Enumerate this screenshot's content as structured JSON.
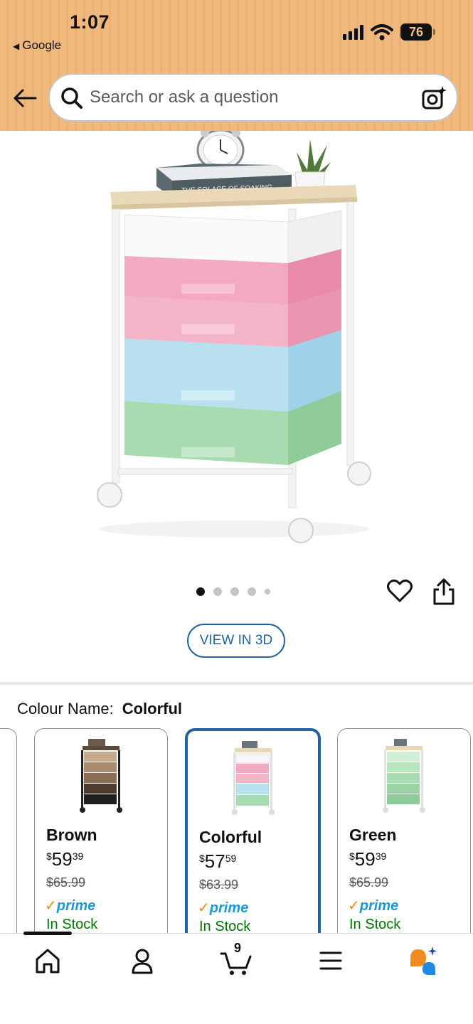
{
  "status_bar": {
    "time": "1:07",
    "back_app": "Google",
    "battery": "76"
  },
  "search": {
    "placeholder": "Search or ask a question"
  },
  "carousel": {
    "view_3d_label": "VIEW IN 3D",
    "dot_count": 5,
    "active_index": 0
  },
  "product_image": {
    "book_title": "THE SOLACE OF SOAKING"
  },
  "colour": {
    "label": "Colour Name:",
    "selected": "Colorful"
  },
  "swatches": [
    {
      "name": "Brown",
      "currency": "$",
      "price_whole": "59",
      "price_fraction": "39",
      "old_price": "$65.99",
      "prime": "prime",
      "stock": "In Stock",
      "selected": false
    },
    {
      "name": "Colorful",
      "currency": "$",
      "price_whole": "57",
      "price_fraction": "59",
      "old_price": "$63.99",
      "prime": "prime",
      "stock": "In Stock",
      "selected": true
    },
    {
      "name": "Green",
      "currency": "$",
      "price_whole": "59",
      "price_fraction": "39",
      "old_price": "$65.99",
      "prime": "prime",
      "stock": "In Stock",
      "selected": false
    }
  ],
  "bottom_nav": {
    "items": [
      "home-icon",
      "account-icon",
      "cart-icon",
      "menu-icon",
      "rufus-icon"
    ],
    "cart_count": "9"
  },
  "colors": {
    "header_bg": "#efb97d",
    "link_blue": "#2162a1",
    "prime_blue": "#1a98d8",
    "stock_green": "#007600",
    "prime_check": "#f08804"
  }
}
